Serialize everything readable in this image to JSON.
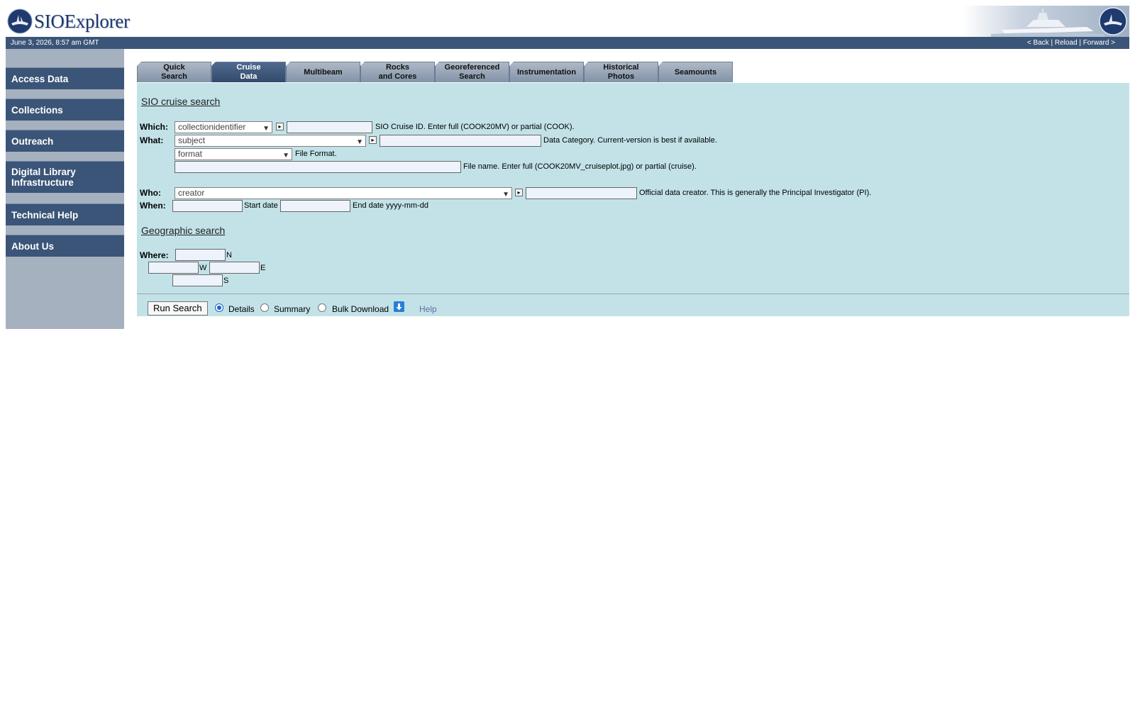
{
  "header": {
    "logo_text": "SIOExplorer"
  },
  "datebar": {
    "date": "June 3, 2026, 8:57 am GMT",
    "back": "< Back",
    "sep1": " | ",
    "reload": "Reload",
    "sep2": " | ",
    "forward": "Forward >"
  },
  "sidebar": {
    "items": [
      {
        "label": "Access Data"
      },
      {
        "label": "Collections"
      },
      {
        "label": "Outreach"
      },
      {
        "label": "Digital Library Infrastructure"
      },
      {
        "label": "Technical Help"
      },
      {
        "label": "About Us"
      }
    ]
  },
  "tabs": [
    {
      "line1": "Quick",
      "line2": "Search"
    },
    {
      "line1": "Cruise",
      "line2": "Data"
    },
    {
      "line1": "Multibeam",
      "line2": ""
    },
    {
      "line1": "Rocks",
      "line2": "and Cores"
    },
    {
      "line1": "Georeferenced",
      "line2": "Search"
    },
    {
      "line1": "Instrumentation",
      "line2": ""
    },
    {
      "line1": "Historical",
      "line2": "Photos"
    },
    {
      "line1": "Seamounts",
      "line2": ""
    }
  ],
  "cruise": {
    "title": "SIO cruise search",
    "which_label": "Which:",
    "which_select": "collectionidentifier",
    "which_hint": "SIO Cruise ID. Enter full (COOK20MV) or partial (COOK).",
    "what_label": "What:",
    "what_select": "subject",
    "what_hint": "Data Category. Current-version is best if available.",
    "format_select": "format",
    "format_hint": "File Format.",
    "filename_hint": "File name. Enter full (COOK20MV_cruiseplot.jpg) or partial (cruise).",
    "who_label": "Who:",
    "who_select": "creator",
    "who_hint": "Official data creator. This is generally the Principal Investigator (PI).",
    "when_label": "When:",
    "start_hint": "Start date",
    "end_hint": "End date yyyy-mm-dd"
  },
  "geo": {
    "title": "Geographic search",
    "where_label": "Where:",
    "n": "N",
    "w": "W",
    "e": "E",
    "s": "S"
  },
  "footer": {
    "run_label": "Run Search",
    "opt_details": "Details",
    "opt_summary": "Summary",
    "opt_bulk": "Bulk Download",
    "selected": "Details",
    "help": "Help"
  },
  "colors": {
    "nav_blue": "#3b5578",
    "panel_bg": "#c2e2e8",
    "sidebar_bg": "#a6b1bf"
  },
  "icons": [
    "globe-logo-icon",
    "picker-icon",
    "download-icon"
  ]
}
